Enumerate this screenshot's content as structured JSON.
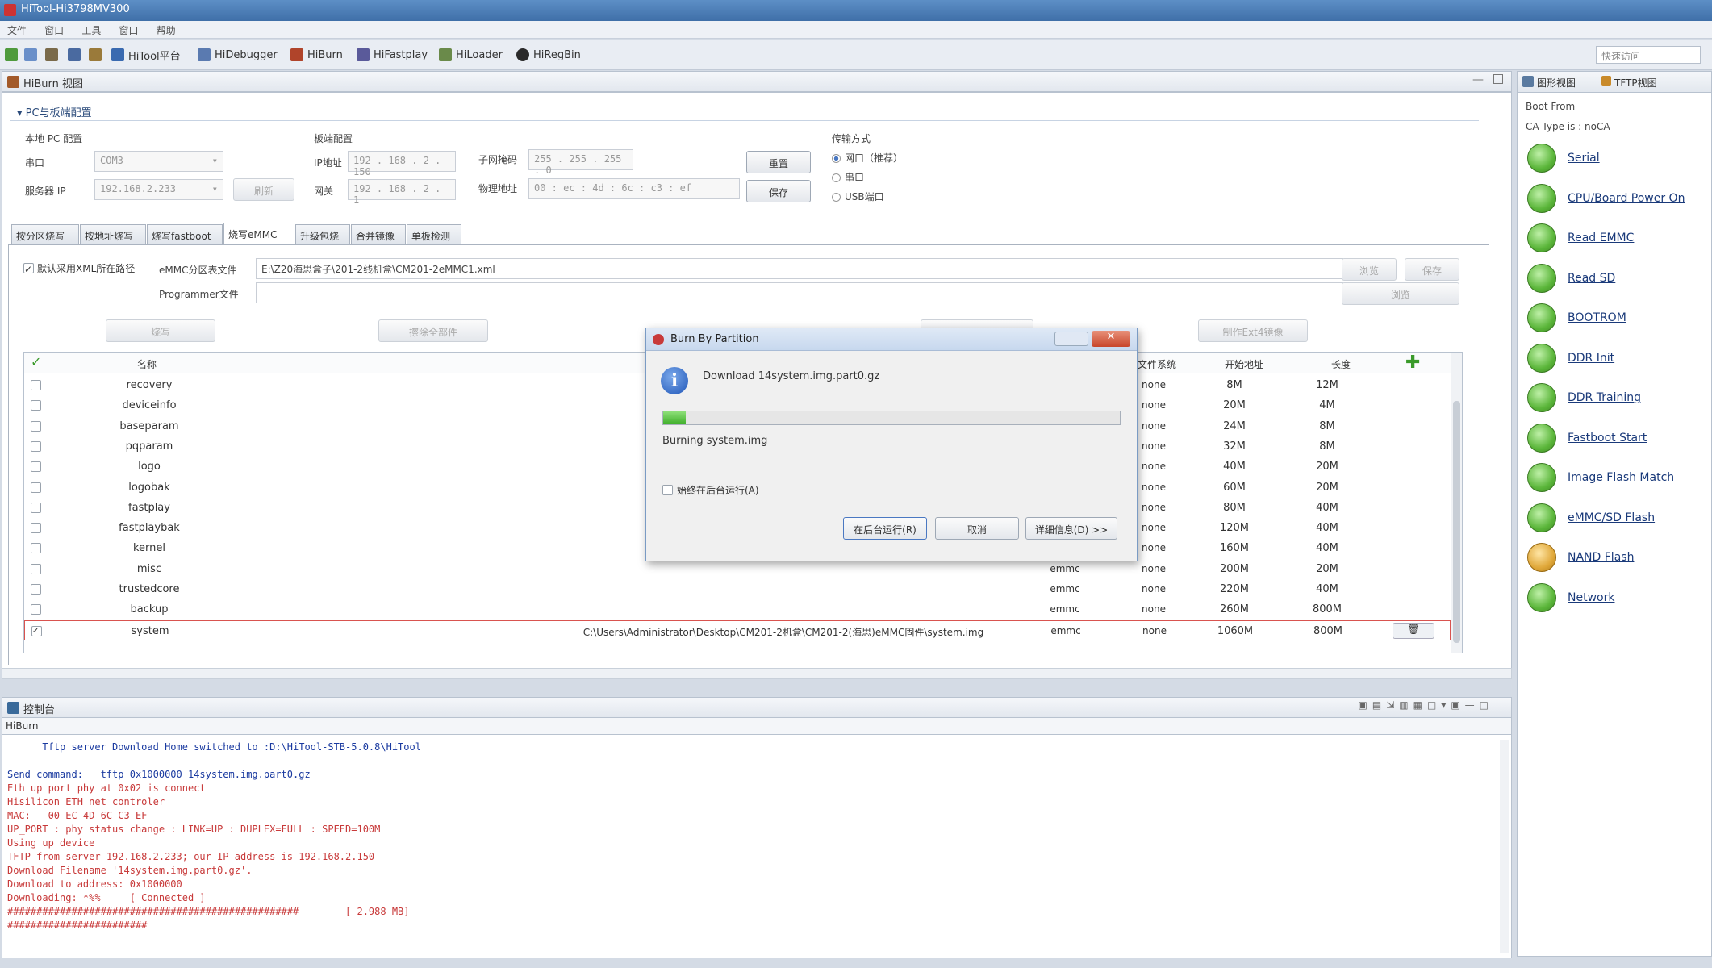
{
  "window": {
    "title": "HiTool-Hi3798MV300"
  },
  "menu": [
    "文件",
    "窗口",
    "工具",
    "窗口",
    "帮助"
  ],
  "toolbar": {
    "items": [
      "HiTool平台",
      "HiDebugger",
      "HiBurn",
      "HiFastplay",
      "HiLoader",
      "HiRegBin"
    ],
    "quick_access": "快速访问"
  },
  "burn_view": {
    "title": "HiBurn 视图",
    "section_title": "PC与板端配置",
    "pc_config": {
      "label": "本地 PC 配置",
      "port_label": "串口",
      "port_value": "COM3",
      "server_ip_label": "服务器 IP",
      "server_ip_value": "192.168.2.233",
      "refresh": "刷新"
    },
    "board_config": {
      "label": "板端配置",
      "ip_label": "IP地址",
      "ip_value": "192 . 168 . 2 . 150",
      "gateway_label": "网关",
      "gateway_value": "192 . 168 . 2 . 1",
      "mask_label": "子网掩码",
      "mask_value": "255 . 255 . 255 . 0",
      "mac_label": "物理地址",
      "mac_value": "00 : ec : 4d : 6c : c3 : ef",
      "btn_update": "重置",
      "btn_save": "保存"
    },
    "transfer": {
      "label": "传输方式",
      "options": [
        "网口（推荐）",
        "串口",
        "USB端口"
      ]
    },
    "tabs": [
      "按分区烧写",
      "按地址烧写",
      "烧写fastboot",
      "烧写eMMC",
      "升级包烧",
      "合并镜像",
      "单板检测"
    ],
    "active_tab": 3,
    "emmc": {
      "default_label": "默认采用XML所在路径",
      "partition_label": "eMMC分区表文件",
      "partition_path": "E:\\Z20海思盒子\\201-2线机盒\\CM201-2eMMC1.xml",
      "programmer_label": "Programmer文件",
      "btn_browse": "浏览",
      "btn_save": "保存",
      "btn_browse2": "浏览",
      "btn_burn": "烧写",
      "btn_erase": "擦除全部件",
      "btn_make_image": "制作Ext4镜像"
    },
    "columns": {
      "name": "名称",
      "fs": "文件系统",
      "start": "开始地址",
      "length": "长度"
    },
    "rows": [
      {
        "name": "recovery",
        "file": "",
        "type": "",
        "fs": "none",
        "start": "8M",
        "len": "12M"
      },
      {
        "name": "deviceinfo",
        "file": "",
        "type": "",
        "fs": "none",
        "start": "20M",
        "len": "4M"
      },
      {
        "name": "baseparam",
        "file": "",
        "type": "",
        "fs": "none",
        "start": "24M",
        "len": "8M"
      },
      {
        "name": "pqparam",
        "file": "",
        "type": "",
        "fs": "none",
        "start": "32M",
        "len": "8M"
      },
      {
        "name": "logo",
        "file": "",
        "type": "",
        "fs": "none",
        "start": "40M",
        "len": "20M"
      },
      {
        "name": "logobak",
        "file": "",
        "type": "",
        "fs": "none",
        "start": "60M",
        "len": "20M"
      },
      {
        "name": "fastplay",
        "file": "",
        "type": "",
        "fs": "none",
        "start": "80M",
        "len": "40M"
      },
      {
        "name": "fastplaybak",
        "file": "",
        "type": "",
        "fs": "none",
        "start": "120M",
        "len": "40M"
      },
      {
        "name": "kernel",
        "file": "",
        "type": "",
        "fs": "none",
        "start": "160M",
        "len": "40M"
      },
      {
        "name": "misc",
        "file": "",
        "type": "emmc",
        "fs": "none",
        "start": "200M",
        "len": "20M"
      },
      {
        "name": "trustedcore",
        "file": "",
        "type": "emmc",
        "fs": "none",
        "start": "220M",
        "len": "40M"
      },
      {
        "name": "backup",
        "file": "",
        "type": "emmc",
        "fs": "none",
        "start": "260M",
        "len": "800M"
      },
      {
        "name": "system",
        "file": "C:\\Users\\Administrator\\Desktop\\CM201-2机盒\\CM201-2(海思)eMMC固件\\system.img",
        "type": "emmc",
        "fs": "none",
        "start": "1060M",
        "len": "800M"
      }
    ]
  },
  "boot_view": {
    "tabs": [
      "图形视图",
      "TFTP视图"
    ],
    "boot_from": "Boot From",
    "ca_type": "CA Type is : noCA",
    "items": [
      "Serial",
      "CPU/Board Power On",
      "Read EMMC",
      "Read SD",
      "BOOTROM",
      "DDR Init",
      "DDR Training",
      "Fastboot Start",
      "Image Flash Match",
      "eMMC/SD Flash",
      "NAND Flash",
      "Network"
    ],
    "colors": {
      "done": "#5bb63a",
      "pending": "#e0a83a"
    }
  },
  "console": {
    "title": "控制台",
    "name": "HiBurn",
    "lines": [
      {
        "text": "      Tftp server Download Home switched to :D:\\HiTool-STB-5.0.8\\HiTool",
        "color": "#1a3aa0"
      },
      {
        "text": "",
        "color": "#1a3aa0"
      },
      {
        "text": "Send command:   tftp 0x1000000 14system.img.part0.gz",
        "color": "#1a3aa0"
      },
      {
        "text": "Eth up port phy at 0x02 is connect",
        "color": "#c83a3a"
      },
      {
        "text": "Hisilicon ETH net controler",
        "color": "#c83a3a"
      },
      {
        "text": "MAC:   00-EC-4D-6C-C3-EF",
        "color": "#c83a3a"
      },
      {
        "text": "UP_PORT : phy status change : LINK=UP : DUPLEX=FULL : SPEED=100M",
        "color": "#c83a3a"
      },
      {
        "text": "Using up device",
        "color": "#c83a3a"
      },
      {
        "text": "TFTP from server 192.168.2.233; our IP address is 192.168.2.150",
        "color": "#c83a3a"
      },
      {
        "text": "Download Filename '14system.img.part0.gz'.",
        "color": "#c83a3a"
      },
      {
        "text": "Download to address: 0x1000000",
        "color": "#c83a3a"
      },
      {
        "text": "Downloading: *%%     [ Connected ]",
        "color": "#c83a3a"
      },
      {
        "text": "##################################################        [ 2.988 MB]",
        "color": "#c83a3a"
      },
      {
        "text": "########################",
        "color": "#c83a3a"
      }
    ]
  },
  "dialog": {
    "title": "Burn By Partition",
    "message": "Download 14system.img.part0.gz",
    "progress": 0.05,
    "status": "Burning system.img",
    "checkbox_label": "始终在后台运行(A)",
    "btn_background": "在后台运行(R)",
    "btn_cancel": "取消",
    "btn_details": "详细信息(D) >>"
  }
}
